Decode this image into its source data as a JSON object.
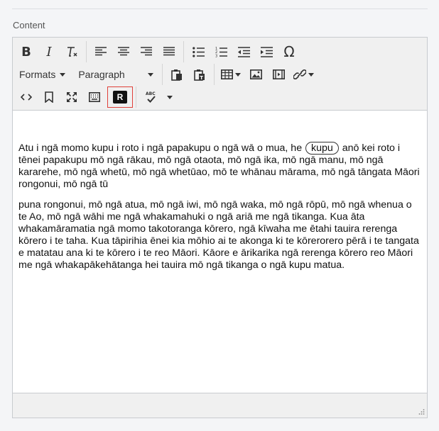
{
  "field": {
    "label": "Content"
  },
  "toolbar": {
    "formats_label": "Formats",
    "block_format_label": "Paragraph",
    "icons": {
      "bold": "bold-icon",
      "italic": "italic-icon",
      "clear_formatting": "clear-formatting-icon",
      "align_left": "align-left-icon",
      "align_center": "align-center-icon",
      "align_right": "align-right-icon",
      "align_justify": "align-justify-icon",
      "bullet_list": "bullet-list-icon",
      "numbered_list": "numbered-list-icon",
      "outdent": "outdent-icon",
      "indent": "indent-icon",
      "special_char": "omega-icon",
      "paste": "paste-icon",
      "paste_text": "paste-text-icon",
      "table": "table-icon",
      "image": "image-icon",
      "media": "media-icon",
      "link": "link-icon",
      "source_code": "code-icon",
      "anchor": "bookmark-icon",
      "fullscreen": "fullscreen-icon",
      "keyboard": "keyboard-icon",
      "spellcheck": "spellcheck-icon"
    },
    "r_button_label": "R",
    "r_button_border_color": "#e0403a"
  },
  "content": {
    "p1_before": "Atu i ngā momo kupu i roto i ngā papakupu o ngā wā o mua, he",
    "p1_highlight": "kupu",
    "p1_after": "anō kei roto i tēnei papakupu mō ngā rākau, mō ngā otaota, mō ngā ika, mō ngā manu, mō ngā kararehe, mō ngā whetū, mō ngā whetūao, mō te whānau mārama, mō ngā tāngata Māori rongonui, mō ngā tū",
    "p2": "puna rongonui, mō ngā atua, mō ngā iwi, mō ngā waka, mō ngā rōpū, mō ngā whenua o te Ao, mō ngā wāhi me ngā whakamahuki o ngā ariā me ngā tikanga. Kua āta whakamāramatia ngā momo takotoranga kōrero, ngā kīwaha me ētahi tauira rerenga kōrero i te taha. Kua tāpirihia ēnei kia mōhio ai te akonga ki te kōrerorero pērā i te tangata e matatau ana ki te kōrero i te reo Māori. Kāore e ārikarika ngā rerenga kōrero reo Māori me ngā whakapākehātanga hei tauira mō ngā tikanga o ngā kupu matua."
  }
}
